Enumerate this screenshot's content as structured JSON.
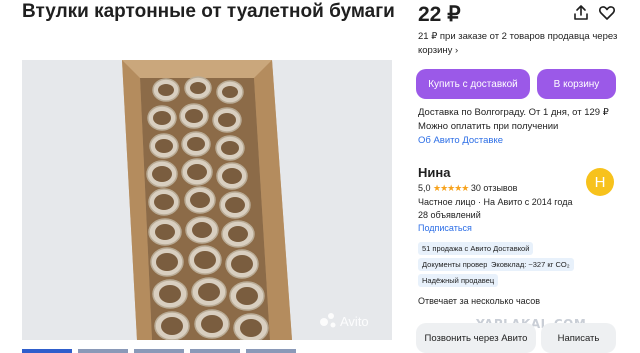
{
  "listing": {
    "title": "Втулки картонные от туалетной бумаги",
    "photo_watermark": "Avito",
    "thumbnail_count": 5
  },
  "price": {
    "amount": "22 ₽",
    "note": "21 ₽ при заказе от 2 товаров продавца через корзину ›"
  },
  "actions": {
    "buy_with_delivery": "Купить с доставкой",
    "add_to_cart": "В корзину",
    "call": "Позвонить через Авито",
    "write": "Написать"
  },
  "delivery": {
    "line1": "Доставка по Волгограду. От 1 дня, от 129 ₽",
    "line2": "Можно оплатить при получении",
    "about_link": "Об Авито Доставке"
  },
  "seller": {
    "name": "Нина",
    "avatar_letter": "Н",
    "rating": "5,0",
    "reviews": "30 отзывов",
    "type": "Частное лицо · На Авито с 2014 года",
    "ads_count": "28 объявлений",
    "subscribe": "Подписаться",
    "badges": [
      "51 продажа с Авито Доставкой",
      "Документы проверены",
      "Эковклад: ~327 кг CO₂",
      "Надёжный продавец"
    ],
    "response_time": "Отвечает за несколько часов"
  },
  "watermark": "YAPLAKAL.COM",
  "colors": {
    "primary_button": "#9b59e8",
    "link": "#2c6ee6",
    "avatar": "#f7c21c",
    "badge_bg": "#e8f1fb",
    "stars": "#f7a21c"
  },
  "icons": [
    "share-icon",
    "heart-icon",
    "star-icon"
  ]
}
